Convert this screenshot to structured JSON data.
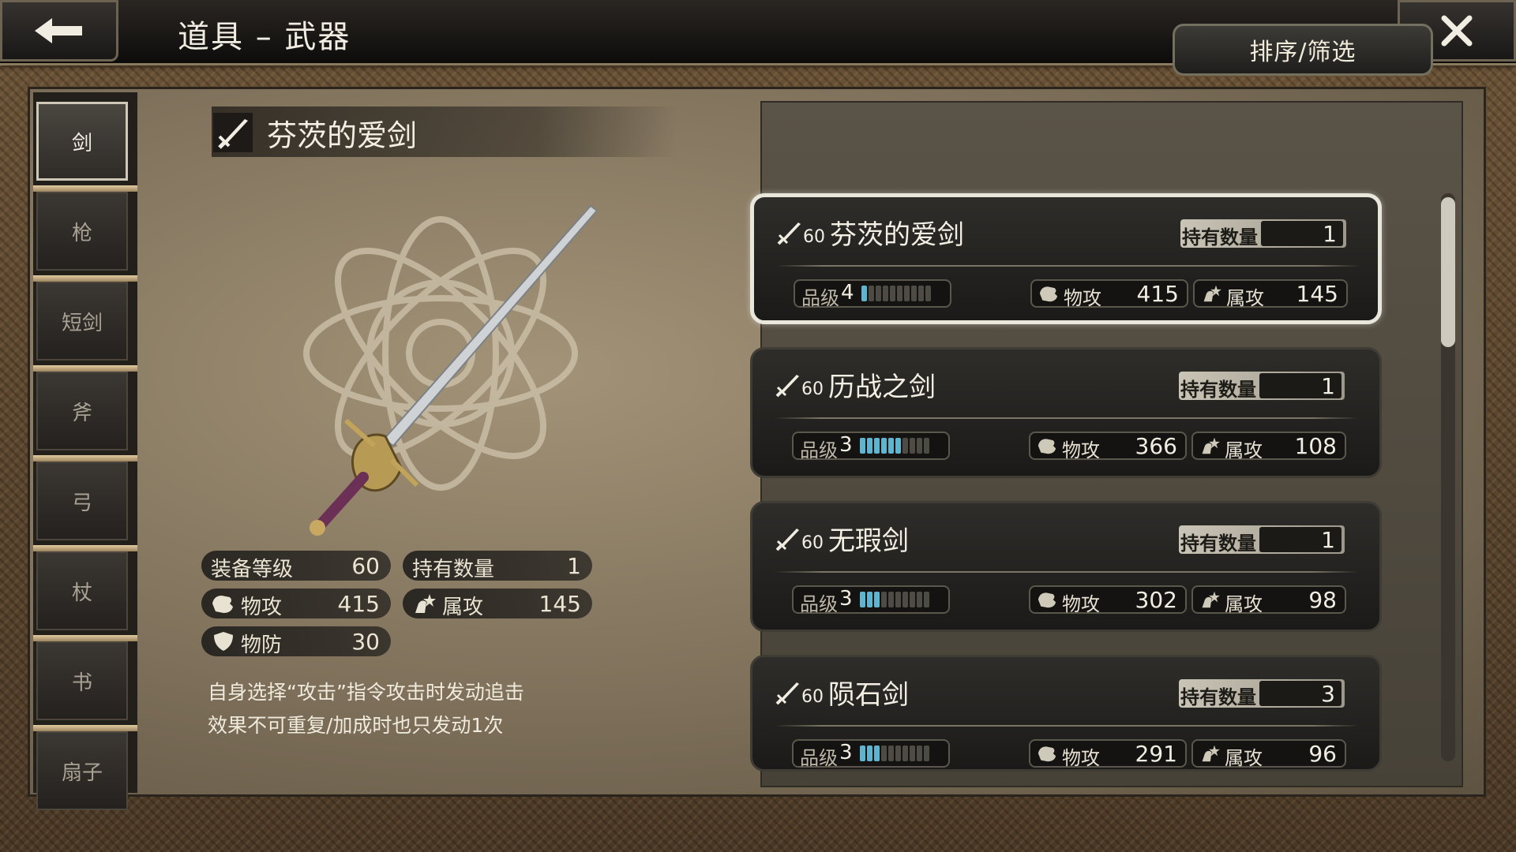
{
  "header": {
    "title": "道具 – 武器",
    "back_icon": "arrow-left-icon",
    "close_icon": "close-x-icon"
  },
  "sidebar": {
    "tabs": [
      {
        "label": "剑",
        "active": true
      },
      {
        "label": "枪"
      },
      {
        "label": "短剑"
      },
      {
        "label": "斧"
      },
      {
        "label": "弓"
      },
      {
        "label": "杖"
      },
      {
        "label": "书"
      },
      {
        "label": "扇子"
      }
    ]
  },
  "detail": {
    "name": "芬茨的爱剑",
    "stats": {
      "equip_level_label": "装备等级",
      "equip_level": "60",
      "owned_label": "持有数量",
      "owned": "1",
      "patk_label": "物攻",
      "patk": "415",
      "eatk_label": "属攻",
      "eatk": "145",
      "pdef_label": "物防",
      "pdef": "30"
    },
    "description": [
      "自身选择“攻击”指令攻击时发动追击",
      "效果不可重复/加成时也只发动1次"
    ]
  },
  "sort_button": "排序/筛选",
  "cards": [
    {
      "level": "60",
      "name": "芬茨的爱剑",
      "owned_label": "持有数量",
      "owned": "1",
      "grade_label": "品级",
      "grade": "4",
      "grade_fill": 1,
      "patk_label": "物攻",
      "patk": "415",
      "eatk_label": "属攻",
      "eatk": "145",
      "selected": true
    },
    {
      "level": "60",
      "name": "历战之剑",
      "owned_label": "持有数量",
      "owned": "1",
      "grade_label": "品级",
      "grade": "3",
      "grade_fill": 6,
      "patk_label": "物攻",
      "patk": "366",
      "eatk_label": "属攻",
      "eatk": "108"
    },
    {
      "level": "60",
      "name": "无瑕剑",
      "owned_label": "持有数量",
      "owned": "1",
      "grade_label": "品级",
      "grade": "3",
      "grade_fill": 3,
      "patk_label": "物攻",
      "patk": "302",
      "eatk_label": "属攻",
      "eatk": "98"
    },
    {
      "level": "60",
      "name": "陨石剑",
      "owned_label": "持有数量",
      "owned": "3",
      "grade_label": "品级",
      "grade": "3",
      "grade_fill": 3,
      "patk_label": "物攻",
      "patk": "291",
      "eatk_label": "属攻",
      "eatk": "96"
    }
  ],
  "colors": {
    "grade_bar_on": "#5fb4d0",
    "grade_bar_off": "#4e4b44"
  }
}
